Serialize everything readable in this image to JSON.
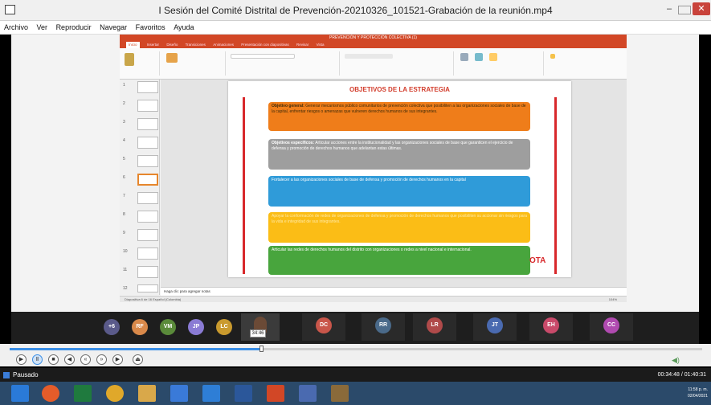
{
  "window": {
    "title": "I Sesión del Comité Distrital de Prevención-20210326_101521-Grabación de la reunión.mp4"
  },
  "menu": [
    "Archivo",
    "Ver",
    "Reproducir",
    "Navegar",
    "Favoritos",
    "Ayuda"
  ],
  "ppt": {
    "title": "PREVENCIÓN Y PROTECCIÓN COLECTIVA (1)",
    "tabs": [
      "Inicio",
      "Insertar",
      "Diseño",
      "Transiciones",
      "Animaciones",
      "Presentación con diapositivas",
      "Revisar",
      "Vista"
    ],
    "notes_placeholder": "Haga clic para agregar notas",
    "status_left": "Diapositiva 6 de 16   Español (Colombia)",
    "zoom": "104%"
  },
  "slide": {
    "title": "OBJETIVOS DE LA ESTRATEGIA",
    "boxes": [
      {
        "label": "Objetivo general:",
        "text": "Generar mecanismos público comunitarios de prevención colectiva que posibiliten a las organizaciones sociales de base de la capital, enfrentar riesgos o amenazas que vulneren derechos humanos de sus integrantes."
      },
      {
        "label": "Objetivos específicos:",
        "text": "Articular acciones entre la institucionalidad y las organizaciones sociales de base que garanticen el ejercicio de defensa y promoción de derechos humanos que adelantan estas últimas."
      },
      {
        "label": "",
        "text": "Fortalecer a las organizaciones sociales de base de defensa y promoción de derechos humanos en la capital"
      },
      {
        "label": "",
        "text": "Apoyar la conformación de redes de organizaciones de defensa y promoción de derechos humanos que posibiliten su accionar sin riesgos para la vida e integridad de sus integrantes."
      },
      {
        "label": "",
        "text": "Articular las redes de derechos humanos del distrito con organizaciones o redes a nivel nacional e internacional."
      }
    ],
    "logo": "OTA"
  },
  "teams": {
    "overflow": "+6",
    "participants": [
      {
        "initials": "RF",
        "color": "#d9894a"
      },
      {
        "initials": "VM",
        "color": "#5a8a3a"
      },
      {
        "initials": "JP",
        "color": "#8a7bd4"
      },
      {
        "initials": "LC",
        "color": "#c99a2e"
      }
    ],
    "presenter_label": "",
    "cams": [
      {
        "initials": "DC",
        "color": "#c9564a",
        "caption": ""
      },
      {
        "initials": "RR",
        "color": "#4a6a8a",
        "caption": ""
      },
      {
        "initials": "LR",
        "color": "#b04a4a",
        "caption": ""
      },
      {
        "initials": "JT",
        "color": "#4a6ab0",
        "caption": ""
      },
      {
        "initials": "EH",
        "color": "#c94a6a",
        "caption": ""
      },
      {
        "initials": "CC",
        "color": "#b04ab0",
        "caption": ""
      }
    ]
  },
  "player": {
    "tooltip_time": "34:46",
    "progress_fraction": 0.363,
    "status": "Pausado",
    "time": "00:34:48 / 01:40:31"
  },
  "taskbar": {
    "clock_time": "11:58 p. m.",
    "clock_date": "02/04/2021"
  }
}
